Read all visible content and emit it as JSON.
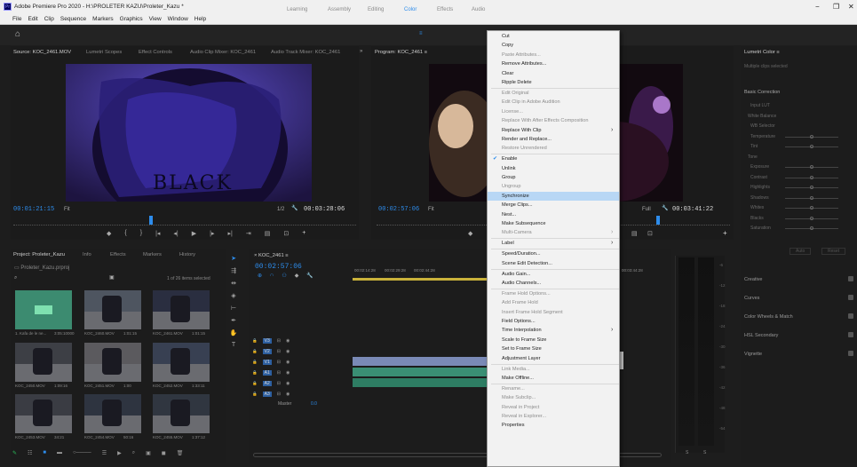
{
  "window": {
    "title": "Adobe Premiere Pro 2020 - H:\\PROLETER KAZU\\Proleter_Kazu *",
    "controls": [
      "−",
      "❐",
      "✕"
    ]
  },
  "menubar": [
    "File",
    "Edit",
    "Clip",
    "Sequence",
    "Markers",
    "Graphics",
    "View",
    "Window",
    "Help"
  ],
  "workspaces": {
    "home_icon": "home-icon",
    "items": [
      "Learning",
      "Assembly",
      "Editing",
      "Color",
      "Effects",
      "Audio"
    ],
    "active": "Color"
  },
  "source_panel": {
    "tabs": [
      "Source: KOC_2461.MOV",
      "Lumetri Scopes",
      "Effect Controls",
      "Audio Clip Mixer: KOC_2461",
      "Audio Track Mixer: KOC_2461"
    ],
    "timecode_in": "00:01:21:15",
    "fit": "Fit",
    "scale": "1/2",
    "timecode_out": "00:03:28:06",
    "video_text": "BLACK"
  },
  "program_panel": {
    "tab": "Program: KOC_2461",
    "timecode_in": "00:02:57:06",
    "fit": "Fit",
    "quality": "Full",
    "timecode_out": "00:03:41:22"
  },
  "project_panel": {
    "tabs": [
      "Project: Proleter_Kazu",
      "Info",
      "Effects",
      "Markers",
      "History"
    ],
    "project_file": "Proleter_Kazu.prproj",
    "items_selected": "1 of 26 items selected",
    "thumbs": [
      {
        "name": "1. Kafa de le ne...",
        "dur": "3:05:10000"
      },
      {
        "name": "KOC_2460.MOV",
        "dur": "1:01:15"
      },
      {
        "name": "KOC_2461.MOV",
        "dur": "1:01:15"
      },
      {
        "name": "KOC_2450.MOV",
        "dur": "1:09:16"
      },
      {
        "name": "KOC_2451.MOV",
        "dur": "1:00"
      },
      {
        "name": "KOC_2452.MOV",
        "dur": "1:33:11"
      },
      {
        "name": "KOC_2453.MOV",
        "dur": "34:21"
      },
      {
        "name": "KOC_2454.MOV",
        "dur": "50:16"
      },
      {
        "name": "KOC_2455.MOV",
        "dur": "1:37:12"
      }
    ]
  },
  "timeline": {
    "tab": "KOC_2461",
    "timecode": "00:02:57:06",
    "ruler": [
      "00:02:14:28",
      "00:02:29:28",
      "00:02:44:28",
      "00:03:44:28"
    ],
    "video_tracks": [
      "V3",
      "V2",
      "V1"
    ],
    "audio_tracks": [
      "A1",
      "A2",
      "A3"
    ],
    "master": "Master",
    "master_val": "0.0"
  },
  "context_menu": {
    "items": [
      {
        "label": "Cut",
        "enabled": true
      },
      {
        "label": "Copy",
        "enabled": true
      },
      {
        "label": "Paste Attributes...",
        "enabled": false
      },
      {
        "label": "Remove Attributes...",
        "enabled": true
      },
      {
        "label": "Clear",
        "enabled": true
      },
      {
        "label": "Ripple Delete",
        "enabled": true,
        "sep_after": true
      },
      {
        "label": "Edit Original",
        "enabled": false
      },
      {
        "label": "Edit Clip in Adobe Audition",
        "enabled": false
      },
      {
        "label": "License...",
        "enabled": false
      },
      {
        "label": "Replace With After Effects Composition",
        "enabled": false
      },
      {
        "label": "Replace With Clip",
        "enabled": true,
        "sub": true
      },
      {
        "label": "Render and Replace...",
        "enabled": true
      },
      {
        "label": "Restore Unrendered",
        "enabled": false,
        "sep_after": true
      },
      {
        "label": "Enable",
        "enabled": true,
        "checked": true
      },
      {
        "label": "Unlink",
        "enabled": true
      },
      {
        "label": "Group",
        "enabled": true
      },
      {
        "label": "Ungroup",
        "enabled": false
      },
      {
        "label": "Synchronize",
        "enabled": true,
        "highlight": true
      },
      {
        "label": "Merge Clips...",
        "enabled": true
      },
      {
        "label": "Nest...",
        "enabled": true
      },
      {
        "label": "Make Subsequence",
        "enabled": true
      },
      {
        "label": "Multi-Camera",
        "enabled": false,
        "sub": true,
        "sep_after": true
      },
      {
        "label": "Label",
        "enabled": true,
        "sub": true,
        "sep_after": true
      },
      {
        "label": "Speed/Duration...",
        "enabled": true
      },
      {
        "label": "Scene Edit Detection...",
        "enabled": true,
        "sep_after": true
      },
      {
        "label": "Audio Gain...",
        "enabled": true
      },
      {
        "label": "Audio Channels...",
        "enabled": true,
        "sep_after": true
      },
      {
        "label": "Frame Hold Options...",
        "enabled": false
      },
      {
        "label": "Add Frame Hold",
        "enabled": false
      },
      {
        "label": "Insert Frame Hold Segment",
        "enabled": false
      },
      {
        "label": "Field Options...",
        "enabled": true
      },
      {
        "label": "Time Interpolation",
        "enabled": true,
        "sub": true
      },
      {
        "label": "Scale to Frame Size",
        "enabled": true
      },
      {
        "label": "Set to Frame Size",
        "enabled": true
      },
      {
        "label": "Adjustment Layer",
        "enabled": true,
        "sep_after": true
      },
      {
        "label": "Link Media...",
        "enabled": false
      },
      {
        "label": "Make Offline...",
        "enabled": true,
        "sep_after": true
      },
      {
        "label": "Rename...",
        "enabled": false
      },
      {
        "label": "Make Subclip...",
        "enabled": false
      },
      {
        "label": "Reveal in Project",
        "enabled": false
      },
      {
        "label": "Reveal in Explorer...",
        "enabled": false
      },
      {
        "label": "Properties",
        "enabled": true
      }
    ]
  },
  "lumetri": {
    "title": "Lumetri Color",
    "subtitle": "Multiple clips selected",
    "sections": [
      "Basic Correction",
      "Creative",
      "Curves",
      "Color Wheels & Match",
      "HSL Secondary",
      "Vignette"
    ],
    "basic": [
      "Input LUT",
      "White Balance",
      "WB Selector",
      "Temperature",
      "Tint",
      "Tone",
      "Exposure",
      "Contrast",
      "Highlights",
      "Shadows",
      "Whites",
      "Blacks",
      "Saturation"
    ],
    "auto_btn": "Auto",
    "reset_btn": "Reset",
    "meter_labels": [
      "-6",
      "-12",
      "-18",
      "-24",
      "-30",
      "-36",
      "-42",
      "-48",
      "-54"
    ],
    "accent": "#2d8ceb"
  }
}
